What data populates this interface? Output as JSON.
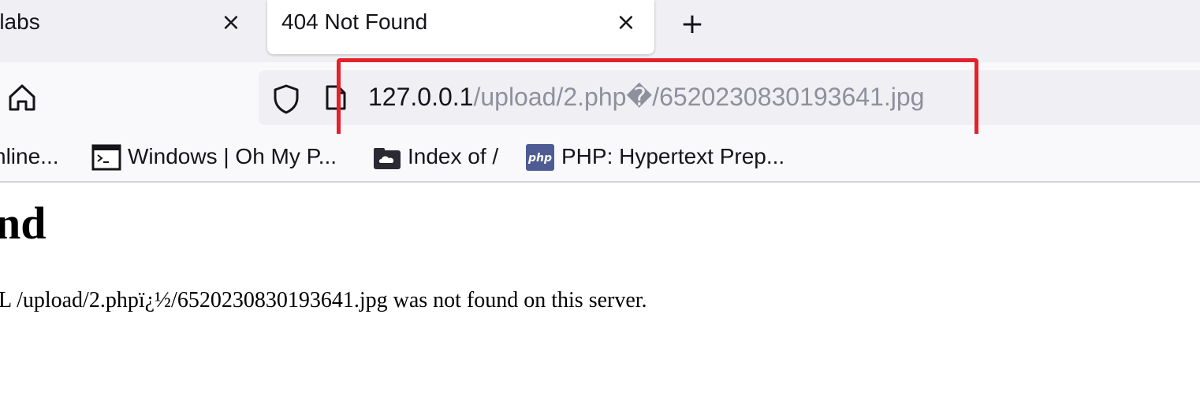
{
  "tabs": [
    {
      "title": "-labs",
      "close_glyph": "×"
    },
    {
      "title": "404 Not Found",
      "close_glyph": "×"
    }
  ],
  "new_tab_glyph": "+",
  "toolbar": {
    "home_icon": "home-icon",
    "shield_icon": "shield-icon",
    "page_icon": "page-icon"
  },
  "address_bar": {
    "host": "127.0.0.1",
    "path": "/upload/2.php�/6520230830193641.jpg"
  },
  "bookmarks": [
    {
      "label": "nline...",
      "icon": ""
    },
    {
      "label": "Windows | Oh My P...",
      "icon": "terminal-icon"
    },
    {
      "label": "Index of /",
      "icon": "cloud-folder-icon"
    },
    {
      "label": "PHP: Hypertext Prep...",
      "icon": "php-icon"
    }
  ],
  "page": {
    "heading": "nd",
    "message": "L /upload/2.phpï¿½/6520230830193641.jpg was not found on this server."
  },
  "colors": {
    "highlight": "#e5202a",
    "tab_bar": "#f0f0f4",
    "url_path": "#8f8f9d"
  }
}
